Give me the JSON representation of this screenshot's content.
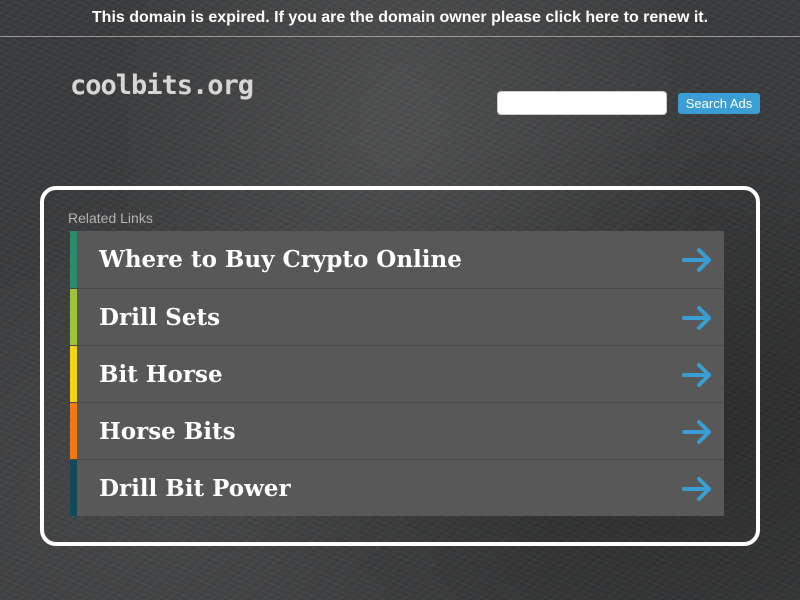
{
  "banner": {
    "text": "This domain is expired. If you are the domain owner please click here to renew it."
  },
  "header": {
    "logo": "coolbits.org",
    "search": {
      "value": "",
      "placeholder": "",
      "button_label": "Search Ads"
    }
  },
  "related": {
    "title": "Related Links",
    "items": [
      {
        "label": "Where to Buy Crypto Online",
        "color": "#2e8b6e"
      },
      {
        "label": "Drill Sets",
        "color": "#9bc43b"
      },
      {
        "label": "Bit Horse",
        "color": "#f2d21b"
      },
      {
        "label": "Horse Bits",
        "color": "#ee7a11"
      },
      {
        "label": "Drill Bit Power",
        "color": "#124a5c"
      }
    ],
    "arrow_icon": "arrow-right-icon",
    "arrow_color": "#3a9ed4"
  }
}
